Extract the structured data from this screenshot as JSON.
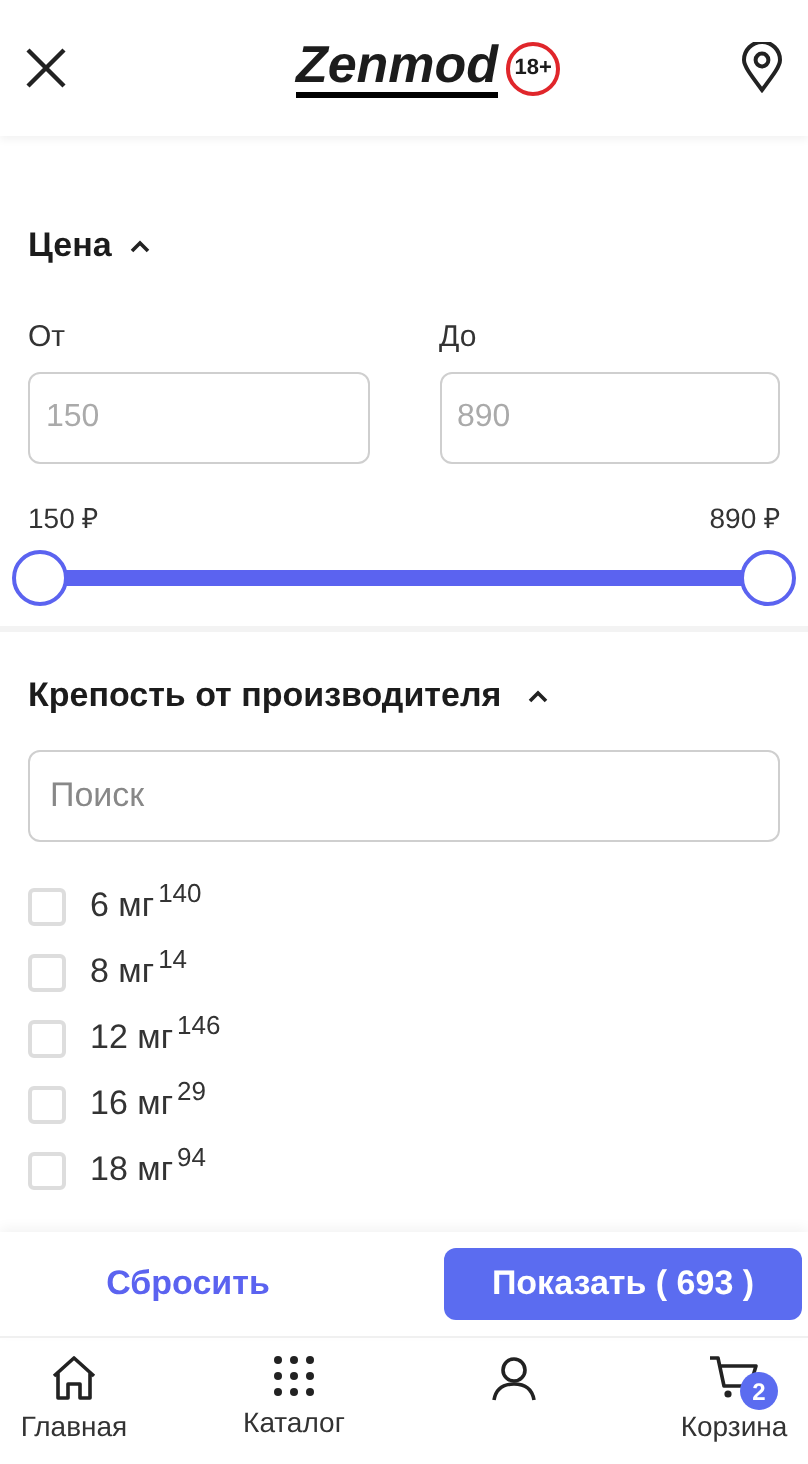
{
  "header": {
    "logo": "Zenmod",
    "age_badge": "18+"
  },
  "price": {
    "title": "Цена",
    "expanded": true,
    "from_label": "От",
    "to_label": "До",
    "from_placeholder": "150",
    "to_placeholder": "890",
    "min_label": "150 ₽",
    "max_label": "890 ₽",
    "handles": [
      {
        "level": 0
      },
      {
        "level": 1
      }
    ]
  },
  "strength": {
    "title": "Крепость от производителя",
    "expanded": true,
    "search_placeholder": "Поиск",
    "options": [
      {
        "label": "6 мг",
        "count": "140",
        "checked": false
      },
      {
        "label": "8 мг",
        "count": "14",
        "checked": false
      },
      {
        "label": "12 мг",
        "count": "146",
        "checked": false
      },
      {
        "label": "16 мг",
        "count": "29",
        "checked": false
      },
      {
        "label": "18 мг",
        "count": "94",
        "checked": false
      }
    ]
  },
  "actions": {
    "reset": "Сбросить",
    "show": "Показать ( 693 )"
  },
  "nav": [
    {
      "kind": "home",
      "label": "Главная"
    },
    {
      "kind": "catalog",
      "label": "Каталог"
    },
    {
      "kind": "profile"
    },
    {
      "kind": "cart",
      "label": "Корзина",
      "badge": "2"
    }
  ]
}
